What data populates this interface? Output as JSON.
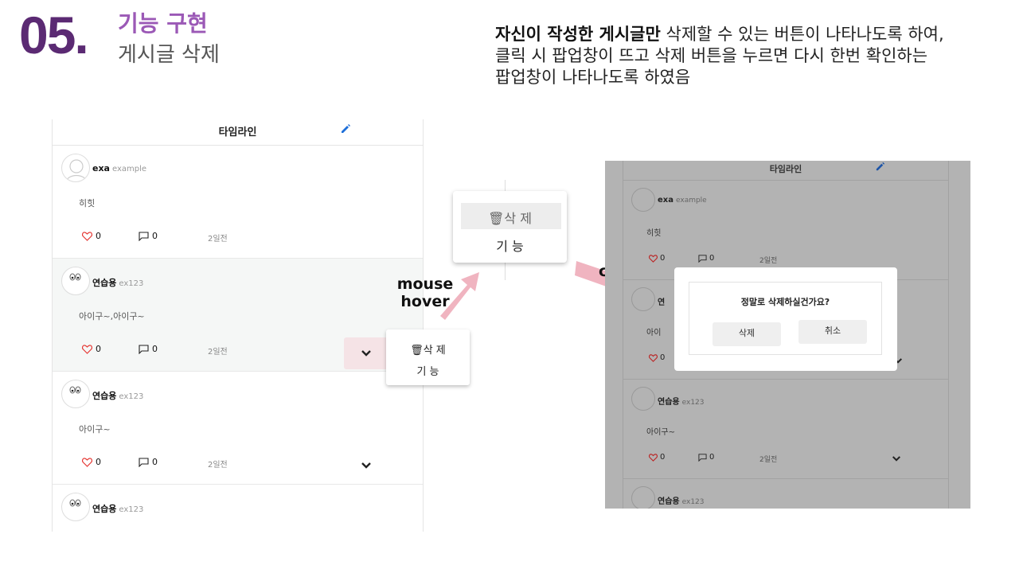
{
  "header": {
    "number": "05.",
    "title": "기능 구현",
    "subtitle": "게시글 삭제",
    "description_bold": "자신이 작성한 게시글만",
    "description_line1_rest": " 삭제할 수 있는 버튼이 나타나도록 하여,",
    "description_line2": "클릭 시 팝업창이 뜨고 삭제 버튼을 누르면 다시 한번 확인하는",
    "description_line3": "팝업창이 나타나도록 하였음"
  },
  "timeline": {
    "title": "타임라인",
    "posts": [
      {
        "name": "exa",
        "id": "example",
        "text": "히힛",
        "likes": "0",
        "comments": "0",
        "time": "2일전"
      },
      {
        "name": "연습용",
        "id": "ex123",
        "text": "아이구~,아이구~",
        "likes": "0",
        "comments": "0",
        "time": "2일전"
      },
      {
        "name": "연습용",
        "id": "ex123",
        "text": "아이구~",
        "likes": "0",
        "comments": "0",
        "time": "2일전"
      },
      {
        "name": "연습용",
        "id": "ex123"
      }
    ]
  },
  "menu": {
    "delete_label": "삭 제",
    "func_label": "기 능"
  },
  "arrows": {
    "hover_line1": "mouse",
    "hover_line2": "hover",
    "click": "click"
  },
  "right_timeline": {
    "title": "타임라인",
    "posts": [
      {
        "name": "exa",
        "id": "example",
        "text": "히힛",
        "likes": "0",
        "comments": "0",
        "time": "2일전"
      },
      {
        "name": "연",
        "text": "아이",
        "likes": "0"
      },
      {
        "name": "연습용",
        "id": "ex123",
        "text": "아이구~",
        "likes": "0",
        "comments": "0",
        "time": "2일전"
      },
      {
        "name": "연습용",
        "id": "ex123"
      }
    ]
  },
  "dialog": {
    "question": "정말로 삭제하실건가요?",
    "confirm": "삭제",
    "cancel": "취소"
  },
  "colors": {
    "accent_purple": "#5b2a73",
    "title_purple": "#9b59b6",
    "arrow_pink": "#f0b4c0",
    "heart_red": "#e53935",
    "pencil_blue": "#1e6fd9"
  }
}
